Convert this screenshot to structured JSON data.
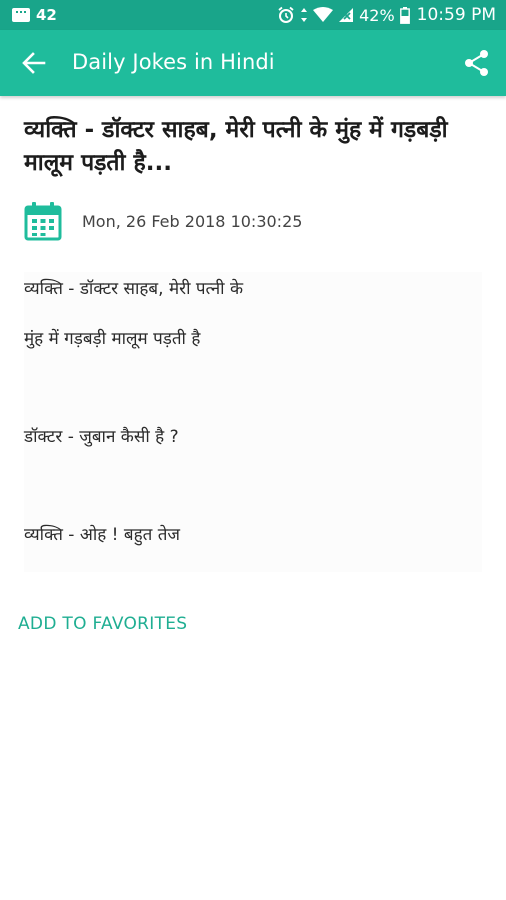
{
  "status_bar": {
    "notification_count": "42",
    "battery_percent": "42%",
    "time": "10:59 PM",
    "icons": [
      "notification-icon",
      "alarm-icon",
      "data-arrows-icon",
      "wifi-icon",
      "signal-icon",
      "battery-icon"
    ]
  },
  "app_bar": {
    "title": "Daily Jokes in Hindi",
    "back_icon": "arrow-left",
    "share_icon": "share"
  },
  "post": {
    "title": "व्यक्ति - डॉक्टर साहब, मेरी पत्नी के  मुंह में गड़बड़ी मालूम पड़ती है...",
    "date": "Mon, 26 Feb 2018 10:30:25",
    "body_lines": [
      "व्यक्ति - डॉक्टर साहब, मेरी पत्नी के",
      "मुंह में गड़बड़ी मालूम पड़ती है",
      "डॉक्टर - जुबान कैसी है ?",
      "व्यक्ति - ओह ! बहुत तेज"
    ]
  },
  "actions": {
    "add_to_favorites": "ADD TO FAVORITES"
  },
  "colors": {
    "status_bar": "#19a58a",
    "app_bar": "#1fbc9c",
    "accent": "#1fae92"
  }
}
